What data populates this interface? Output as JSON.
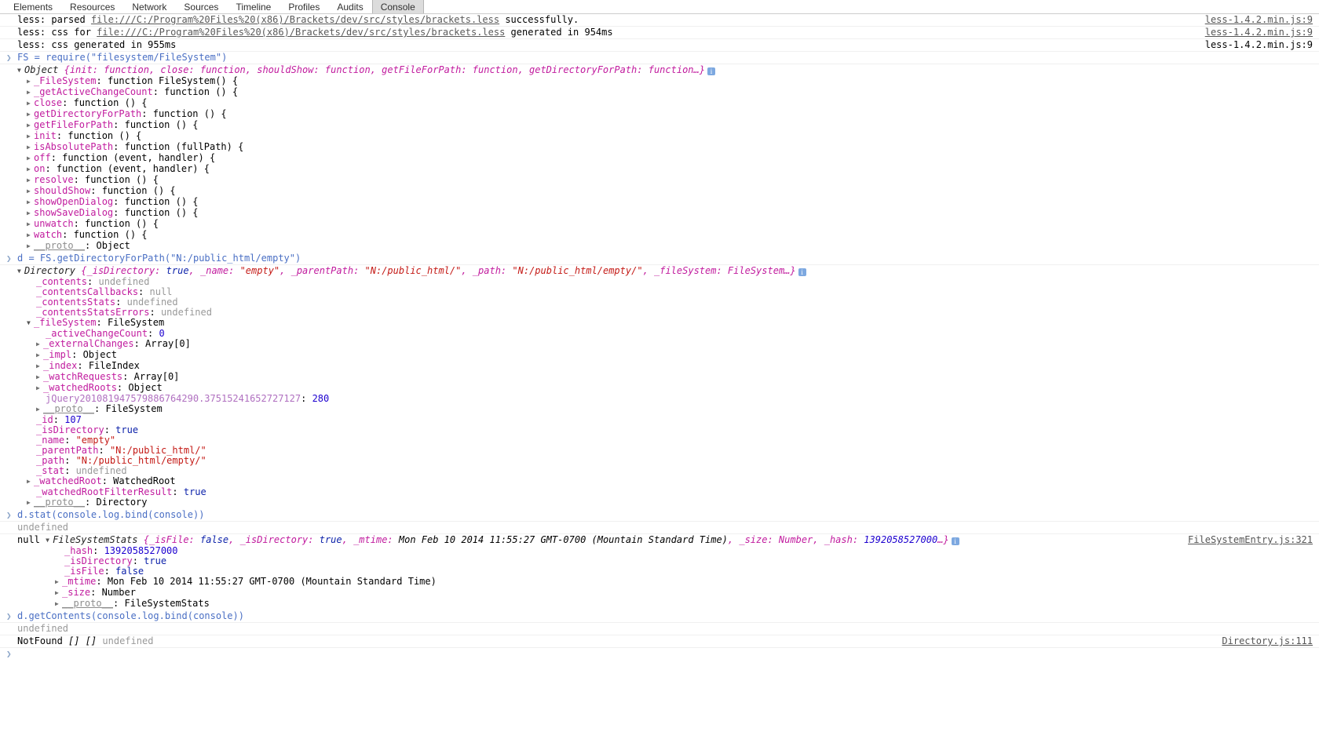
{
  "tabs": [
    {
      "label": "Elements",
      "selected": false
    },
    {
      "label": "Resources",
      "selected": false
    },
    {
      "label": "Network",
      "selected": false
    },
    {
      "label": "Sources",
      "selected": false
    },
    {
      "label": "Timeline",
      "selected": false
    },
    {
      "label": "Profiles",
      "selected": false
    },
    {
      "label": "Audits",
      "selected": false
    },
    {
      "label": "Console",
      "selected": true
    }
  ],
  "icons": {
    "prompt": "❯",
    "triangle_closed": "▶",
    "triangle_open": "▼",
    "info": "i"
  },
  "colors": {
    "input_blue": "#4a6fc4",
    "key_magenta": "#c11b9e",
    "string_red": "#c41a16",
    "number_blue": "#1c00cf",
    "undefined_grey": "#999999",
    "tab_selected_bg": "#dcdcdc",
    "info_icon_blue": "#7da8e0"
  },
  "source_links": {
    "less": "less-1.4.2.min.js:9",
    "filesystementry": "FileSystemEntry.js:321",
    "directory": "Directory.js:111"
  },
  "logs": {
    "less_parsed": {
      "prefix": "less: parsed ",
      "url": "file:///C:/Program%20Files%20(x86)/Brackets/dev/src/styles/brackets.less",
      "suffix": " successfully."
    },
    "less_css_for": {
      "prefix": "less: css for ",
      "url": "file:///C:/Program%20Files%20(x86)/Brackets/dev/src/styles/brackets.less",
      "suffix": " generated in 954ms"
    },
    "less_generated": "less: css generated in 955ms"
  },
  "commands": {
    "require_fs": "FS = require(\"filesystem/FileSystem\")",
    "get_dir": "d = FS.getDirectoryForPath(\"N:/public_html/empty\")",
    "d_stat": "d.stat(console.log.bind(console))",
    "d_getcontents": "d.getContents(console.log.bind(console))"
  },
  "fs_object": {
    "preview": "Object {init: function, close: function, shouldShow: function, getFileForPath: function, getDirectoryForPath: function…}",
    "preview_type": "Object",
    "preview_body": "{init: function, close: function, shouldShow: function, getFileForPath: function, getDirectoryForPath: function…}",
    "props": [
      {
        "name": "_FileSystem",
        "value": "function FileSystem() {",
        "expandable": true
      },
      {
        "name": "_getActiveChangeCount",
        "value": "function () {",
        "expandable": true
      },
      {
        "name": "close",
        "value": "function () {",
        "expandable": true
      },
      {
        "name": "getDirectoryForPath",
        "value": "function () {",
        "expandable": true
      },
      {
        "name": "getFileForPath",
        "value": "function () {",
        "expandable": true
      },
      {
        "name": "init",
        "value": "function () {",
        "expandable": true
      },
      {
        "name": "isAbsolutePath",
        "value": "function (fullPath) {",
        "expandable": true
      },
      {
        "name": "off",
        "value": "function (event, handler) {",
        "expandable": true
      },
      {
        "name": "on",
        "value": "function (event, handler) {",
        "expandable": true
      },
      {
        "name": "resolve",
        "value": "function () {",
        "expandable": true
      },
      {
        "name": "shouldShow",
        "value": "function () {",
        "expandable": true
      },
      {
        "name": "showOpenDialog",
        "value": "function () {",
        "expandable": true
      },
      {
        "name": "showSaveDialog",
        "value": "function () {",
        "expandable": true
      },
      {
        "name": "unwatch",
        "value": "function () {",
        "expandable": true
      },
      {
        "name": "watch",
        "value": "function () {",
        "expandable": true
      },
      {
        "name": "__proto__",
        "value": "Object",
        "expandable": true
      }
    ]
  },
  "directory_object": {
    "type": "Directory",
    "preview_parts": {
      "p1": "{_isDirectory: ",
      "v1": "true",
      "p2": ", _name: ",
      "v2": "\"empty\"",
      "p3": ", _parentPath: ",
      "v3": "\"N:/public_html/\"",
      "p4": ", _path: ",
      "v4": "\"N:/public_html/empty/\"",
      "p5": ", _fileSystem: FileSystem…}"
    },
    "props": [
      {
        "name": "_contents",
        "value": "undefined",
        "kind": "undef",
        "expandable": false,
        "indent": 2
      },
      {
        "name": "_contentsCallbacks",
        "value": "null",
        "kind": "undef",
        "expandable": false,
        "indent": 2
      },
      {
        "name": "_contentsStats",
        "value": "undefined",
        "kind": "undef",
        "expandable": false,
        "indent": 2
      },
      {
        "name": "_contentsStatsErrors",
        "value": "undefined",
        "kind": "undef",
        "expandable": false,
        "indent": 2
      },
      {
        "name": "_fileSystem",
        "value": "FileSystem",
        "kind": "plain",
        "expandable": true,
        "expanded": true,
        "indent": 2
      },
      {
        "name": "_activeChangeCount",
        "value": "0",
        "kind": "num",
        "expandable": false,
        "indent": 4
      },
      {
        "name": "_externalChanges",
        "value": "Array[0]",
        "kind": "plain",
        "expandable": true,
        "indent": 3
      },
      {
        "name": "_impl",
        "value": "Object",
        "kind": "plain",
        "expandable": true,
        "indent": 3
      },
      {
        "name": "_index",
        "value": "FileIndex",
        "kind": "plain",
        "expandable": true,
        "indent": 3
      },
      {
        "name": "_watchRequests",
        "value": "Array[0]",
        "kind": "plain",
        "expandable": true,
        "indent": 3
      },
      {
        "name": "_watchedRoots",
        "value": "Object",
        "kind": "plain",
        "expandable": true,
        "indent": 3
      },
      {
        "name": "jQuery201081947579886764290.37515241652727127",
        "value": "280",
        "kind": "num",
        "expandable": false,
        "indent": 4,
        "jquery": true
      },
      {
        "name": "__proto__",
        "value": "FileSystem",
        "kind": "plain",
        "expandable": true,
        "proto": true,
        "indent": 3
      },
      {
        "name": "_id",
        "value": "107",
        "kind": "num",
        "expandable": false,
        "indent": 2
      },
      {
        "name": "_isDirectory",
        "value": "true",
        "kind": "bool",
        "expandable": false,
        "indent": 2
      },
      {
        "name": "_name",
        "value": "\"empty\"",
        "kind": "str",
        "expandable": false,
        "indent": 2
      },
      {
        "name": "_parentPath",
        "value": "\"N:/public_html/\"",
        "kind": "str",
        "expandable": false,
        "indent": 2
      },
      {
        "name": "_path",
        "value": "\"N:/public_html/empty/\"",
        "kind": "str",
        "expandable": false,
        "indent": 2
      },
      {
        "name": "_stat",
        "value": "undefined",
        "kind": "undef",
        "expandable": false,
        "indent": 2
      },
      {
        "name": "_watchedRoot",
        "value": "WatchedRoot",
        "kind": "plain",
        "expandable": true,
        "indent": 1
      },
      {
        "name": "_watchedRootFilterResult",
        "value": "true",
        "kind": "bool",
        "expandable": false,
        "indent": 2
      },
      {
        "name": "__proto__",
        "value": "Directory",
        "kind": "plain",
        "expandable": true,
        "proto": true,
        "indent": 1
      }
    ]
  },
  "stat_result": {
    "undefined_line": "undefined",
    "null_token": "null",
    "type": "FileSystemStats",
    "preview_parts": {
      "p1": "{_isFile: ",
      "v1": "false",
      "p2": ", _isDirectory: ",
      "v2": "true",
      "p3": ", _mtime: ",
      "v3": "Mon Feb 10 2014 11:55:27 GMT-0700 (Mountain Standard Time)",
      "p4": ", _size: Number, _hash: ",
      "v4": "1392058527000",
      "p5": "…}"
    },
    "props": [
      {
        "name": "_hash",
        "value": "1392058527000",
        "kind": "num",
        "expandable": false
      },
      {
        "name": "_isDirectory",
        "value": "true",
        "kind": "bool",
        "expandable": false
      },
      {
        "name": "_isFile",
        "value": "false",
        "kind": "bool",
        "expandable": false
      },
      {
        "name": "_mtime",
        "value": "Mon Feb 10 2014 11:55:27 GMT-0700 (Mountain Standard Time)",
        "kind": "plain",
        "expandable": true
      },
      {
        "name": "_size",
        "value": "Number",
        "kind": "plain",
        "expandable": true
      },
      {
        "name": "__proto__",
        "value": "FileSystemStats",
        "kind": "plain",
        "expandable": true,
        "proto": true
      }
    ]
  },
  "getcontents_result": {
    "undefined_line": "undefined",
    "notfound_line": "NotFound [] [] undefined",
    "notfound_token": "NotFound",
    "arrays": "[] []",
    "undef_token": "undefined"
  }
}
